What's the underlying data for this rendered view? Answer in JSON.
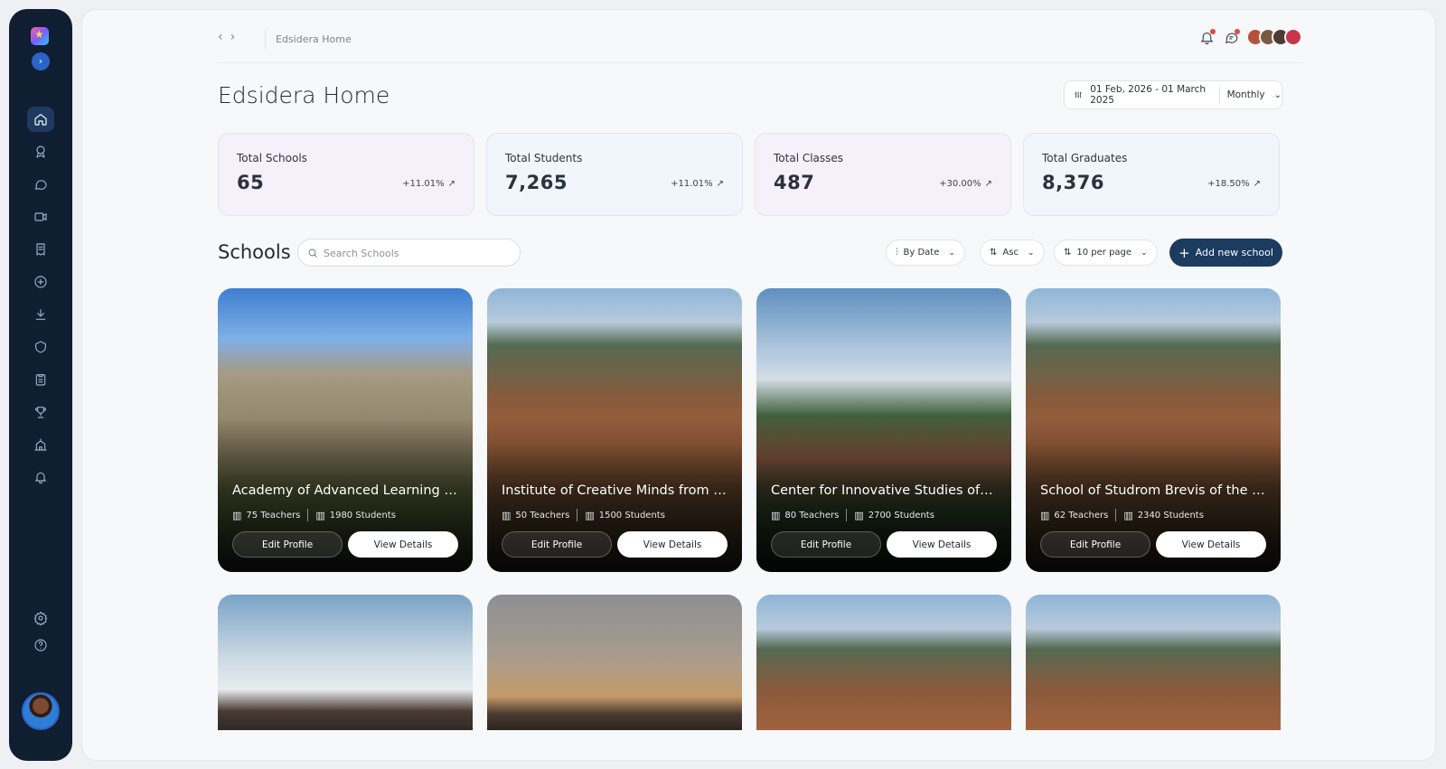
{
  "breadcrumb": "Edsidera Home",
  "page_title": "Edsidera Home",
  "nav": {
    "back": "‹",
    "forward": "›"
  },
  "date_filter": {
    "range": "01 Feb, 2026 - 01 March 2025",
    "period": "Monthly"
  },
  "stats": [
    {
      "label": "Total Schools",
      "value": "65",
      "change": "+11.01%"
    },
    {
      "label": "Total Students",
      "value": "7,265",
      "change": "+11.01%"
    },
    {
      "label": "Total Classes",
      "value": "487",
      "change": "+30.00%"
    },
    {
      "label": "Total Graduates",
      "value": "8,376",
      "change": "+18.50%"
    }
  ],
  "schools": {
    "title": "Schools",
    "search_placeholder": "Search Schools",
    "filters": {
      "sort_by": "By Date",
      "order": "Asc",
      "per_page": "10 per page"
    },
    "add_button": "Add new school",
    "cards": [
      {
        "name": "Academy of Advanced Learning in...",
        "teachers": "75 Teachers",
        "students": "1980 Students",
        "edit": "Edit Profile",
        "view": "View Details"
      },
      {
        "name": "Institute of Creative Minds from th...",
        "teachers": "50 Teachers",
        "students": "1500 Students",
        "edit": "Edit Profile",
        "view": "View Details"
      },
      {
        "name": "Center for Innovative Studies of th...",
        "teachers": "80 Teachers",
        "students": "2700 Students",
        "edit": "Edit Profile",
        "view": "View Details"
      },
      {
        "name": "School of Studrom Brevis of the Gr...",
        "teachers": "62 Teachers",
        "students": "2340 Students",
        "edit": "Edit Profile",
        "view": "View Details"
      }
    ]
  },
  "colors": {
    "sidebar_bg": "#0f1e31",
    "primary_button": "#1b3b5f",
    "stat_card_pink": "#f6f0fb",
    "stat_card_blue": "#f0f6fb"
  },
  "sidebar_icons": [
    "home-icon",
    "award-icon",
    "chat-icon",
    "video-icon",
    "receipt-icon",
    "plus-circle-icon",
    "download-icon",
    "shield-icon",
    "clipboard-icon",
    "trophy-icon",
    "school-icon",
    "bell-icon",
    "settings-icon",
    "help-icon"
  ]
}
